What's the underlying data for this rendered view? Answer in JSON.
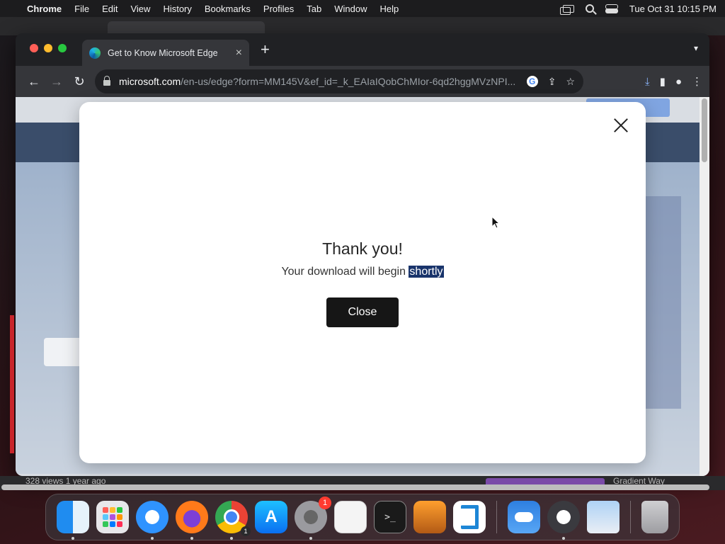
{
  "menubar": {
    "app_name": "Chrome",
    "menus": [
      "File",
      "Edit",
      "View",
      "History",
      "Bookmarks",
      "Profiles",
      "Tab",
      "Window",
      "Help"
    ],
    "clock": "Tue Oct 31  10:15 PM"
  },
  "browser": {
    "tab_title": "Get to Know Microsoft Edge",
    "new_tab_label": "+",
    "url_host": "microsoft.com",
    "url_rest": "/en-us/edge?form=MM145V&ef_id=_k_EAIaIQobChMIor-6qd2hggMVzNPI..."
  },
  "modal": {
    "heading": "Thank you!",
    "message_prefix": "Your download will begin ",
    "message_selected": "shortly",
    "close_button_label": "Close"
  },
  "background_page": {
    "footer_left": "328 views  1 year ago",
    "footer_right": "Gradient Way"
  },
  "dock": {
    "apps": [
      "Finder",
      "Launchpad",
      "Safari",
      "Firefox",
      "Chrome",
      "App Store",
      "System Settings",
      "TextEdit",
      "Terminal",
      "GarageBand",
      "Visual Studio Code",
      "Weather",
      "QuickTime Player",
      "Preview",
      "Trash"
    ],
    "settings_badge": "1",
    "chrome_badge": "1"
  }
}
